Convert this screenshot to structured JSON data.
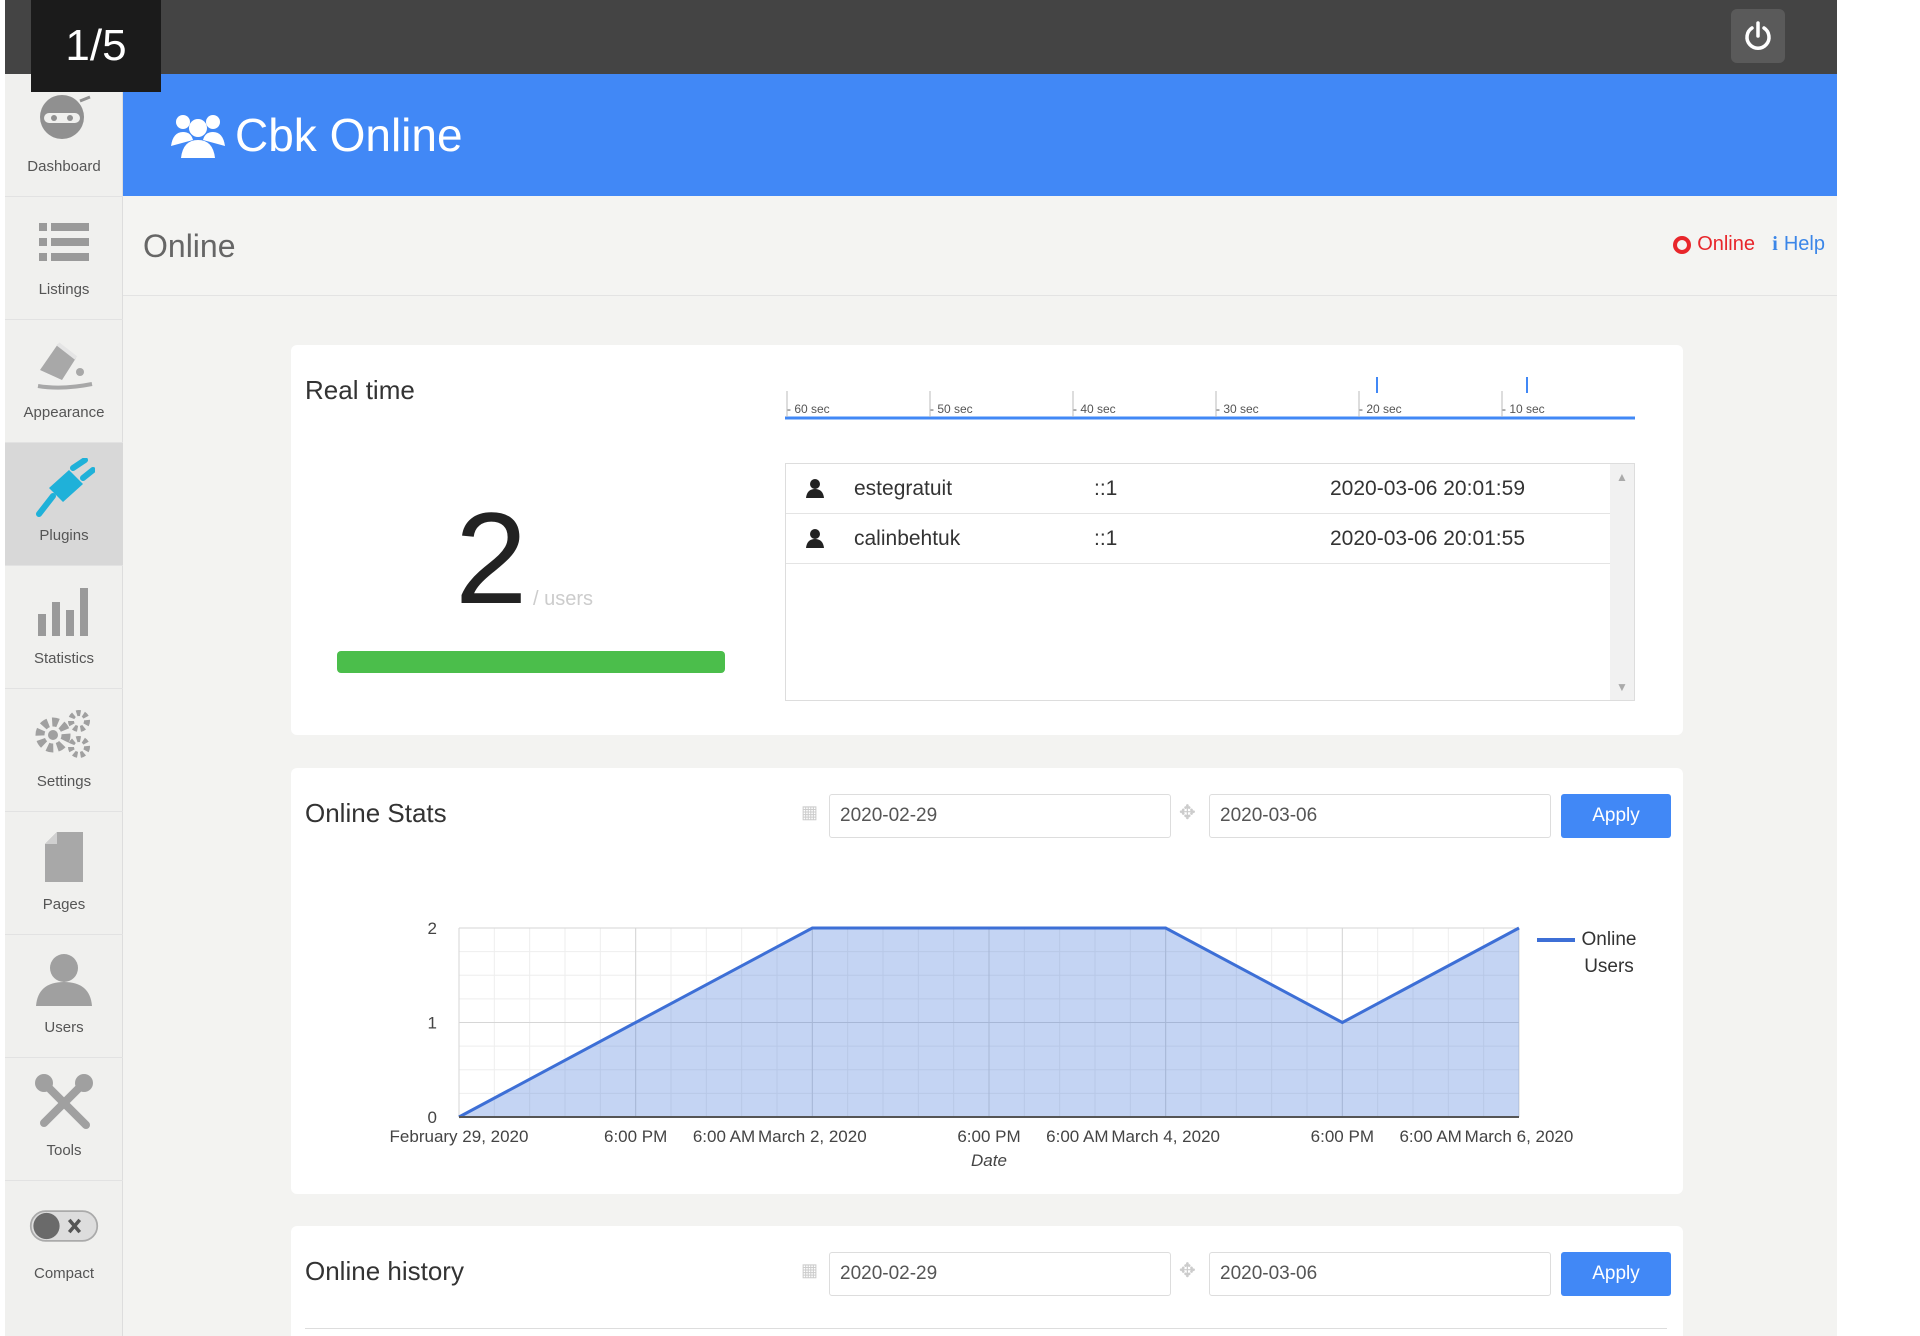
{
  "slide_counter": "1/5",
  "sidebar": {
    "items": [
      {
        "label": "Dashboard",
        "icon": "dashboard-icon"
      },
      {
        "label": "Listings",
        "icon": "listings-icon"
      },
      {
        "label": "Appearance",
        "icon": "appearance-icon"
      },
      {
        "label": "Plugins",
        "icon": "plugin-icon",
        "active": true
      },
      {
        "label": "Statistics",
        "icon": "statistics-icon"
      },
      {
        "label": "Settings",
        "icon": "settings-icon"
      },
      {
        "label": "Pages",
        "icon": "pages-icon"
      },
      {
        "label": "Users",
        "icon": "users-icon"
      },
      {
        "label": "Tools",
        "icon": "tools-icon"
      },
      {
        "label": "Compact",
        "icon": "compact-toggle-icon"
      }
    ]
  },
  "header": {
    "title": "Cbk Online",
    "icon": "users-group-icon"
  },
  "page": {
    "title": "Online",
    "online_link": "Online",
    "help_link": "Help"
  },
  "realtime": {
    "title": "Real time",
    "count": "2",
    "unit": "/ users",
    "timeline_labels": [
      "- 60 sec",
      "- 50 sec",
      "- 40 sec",
      "- 30 sec",
      "- 20 sec",
      "- 10 sec"
    ],
    "users": [
      {
        "name": "estegratuit",
        "ip": "::1",
        "time": "2020-03-06 20:01:59"
      },
      {
        "name": "calinbehtuk",
        "ip": "::1",
        "time": "2020-03-06 20:01:55"
      }
    ]
  },
  "stats": {
    "title": "Online Stats",
    "date_from": "2020-02-29",
    "date_to": "2020-03-06",
    "apply": "Apply"
  },
  "history": {
    "title": "Online history",
    "date_from": "2020-02-29",
    "date_to": "2020-03-06",
    "apply": "Apply"
  },
  "colors": {
    "accent": "#4188f6",
    "header": "#4188f6",
    "online": "#e8262b",
    "help": "#3b86e8",
    "progress": "#4bbe4b",
    "series": "#3d6fd6"
  },
  "chart_data": {
    "type": "area",
    "x": [
      "February 29, 2020",
      "6:00 PM",
      "6:00 AM",
      "March 2, 2020",
      "6:00 PM",
      "6:00 AM",
      "March 4, 2020",
      "6:00 PM",
      "6:00 AM",
      "March 6, 2020"
    ],
    "tick_labels": [
      "February 29, 2020",
      "6:00 PM",
      "6:00 AM",
      "March 2, 2020",
      "6:00 PM",
      "6:00 AM",
      "March 4, 2020",
      "6:00 PM",
      "6:00 AM",
      "March 6, 2020"
    ],
    "series": [
      {
        "name": "Online Users",
        "points": [
          {
            "x": "2020-02-29",
            "y": 0
          },
          {
            "x": "2020-03-01",
            "y": 1
          },
          {
            "x": "2020-03-02",
            "y": 2
          },
          {
            "x": "2020-03-03",
            "y": 2
          },
          {
            "x": "2020-03-04",
            "y": 2
          },
          {
            "x": "2020-03-05",
            "y": 1
          },
          {
            "x": "2020-03-06",
            "y": 2
          }
        ]
      }
    ],
    "xlabel": "Date",
    "ylabel": "",
    "ylim": [
      0,
      2
    ],
    "yticks": [
      0,
      1,
      2
    ],
    "grid": true,
    "legend": "right"
  }
}
